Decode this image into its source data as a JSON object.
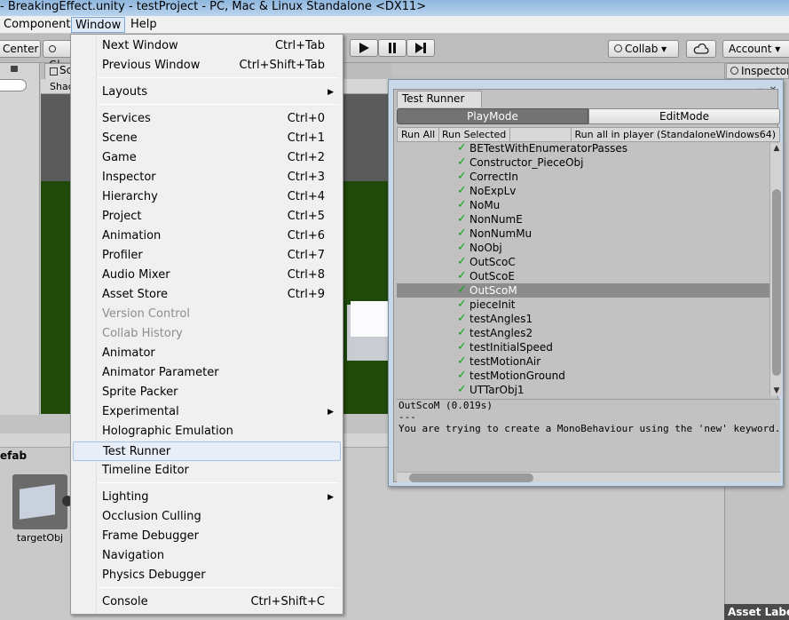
{
  "window_title": "- BreakingEffect.unity - testProject - PC, Mac & Linux Standalone <DX11>",
  "menubar": {
    "items": [
      {
        "label": "Component"
      },
      {
        "label": "Window"
      },
      {
        "label": "Help"
      }
    ]
  },
  "toolbar": {
    "center_label": "Center",
    "global_label": "Gl",
    "collab_label": "Collab ▾",
    "account_label": "Account ▾",
    "play_icon": "play-icon",
    "pause_icon": "pause-icon",
    "step_icon": "step-icon",
    "cloud_icon": "cloud-icon"
  },
  "scene": {
    "tab_label": "Sc",
    "shading_label": "Shad"
  },
  "inspector": {
    "tab_label": "Inspector"
  },
  "project": {
    "title": "efab",
    "asset_name": "targetObj"
  },
  "asset_labels": "Asset Labels",
  "window_menu": {
    "items": [
      {
        "label": "Next Window",
        "shortcut": "Ctrl+Tab"
      },
      {
        "label": "Previous Window",
        "shortcut": "Ctrl+Shift+Tab"
      },
      {
        "label": "Layouts",
        "shortcut": ""
      },
      {
        "label": "Services",
        "shortcut": "Ctrl+0"
      },
      {
        "label": "Scene",
        "shortcut": "Ctrl+1"
      },
      {
        "label": "Game",
        "shortcut": "Ctrl+2"
      },
      {
        "label": "Inspector",
        "shortcut": "Ctrl+3"
      },
      {
        "label": "Hierarchy",
        "shortcut": "Ctrl+4"
      },
      {
        "label": "Project",
        "shortcut": "Ctrl+5"
      },
      {
        "label": "Animation",
        "shortcut": "Ctrl+6"
      },
      {
        "label": "Profiler",
        "shortcut": "Ctrl+7"
      },
      {
        "label": "Audio Mixer",
        "shortcut": "Ctrl+8"
      },
      {
        "label": "Asset Store",
        "shortcut": "Ctrl+9"
      },
      {
        "label": "Version Control",
        "shortcut": ""
      },
      {
        "label": "Collab History",
        "shortcut": ""
      },
      {
        "label": "Animator",
        "shortcut": ""
      },
      {
        "label": "Animator Parameter",
        "shortcut": ""
      },
      {
        "label": "Sprite Packer",
        "shortcut": ""
      },
      {
        "label": "Experimental",
        "shortcut": ""
      },
      {
        "label": "Holographic Emulation",
        "shortcut": ""
      },
      {
        "label": "Test Runner",
        "shortcut": ""
      },
      {
        "label": "Timeline Editor",
        "shortcut": ""
      },
      {
        "label": "Lighting",
        "shortcut": ""
      },
      {
        "label": "Occlusion Culling",
        "shortcut": ""
      },
      {
        "label": "Frame Debugger",
        "shortcut": ""
      },
      {
        "label": "Navigation",
        "shortcut": ""
      },
      {
        "label": "Physics Debugger",
        "shortcut": ""
      },
      {
        "label": "Console",
        "shortcut": "Ctrl+Shift+C"
      }
    ]
  },
  "test_runner": {
    "tab_label": "Test Runner",
    "modes": [
      "PlayMode",
      "EditMode"
    ],
    "active_mode": "PlayMode",
    "run_all": "Run All",
    "run_selected": "Run Selected",
    "run_all_player": "Run all in player (StandaloneWindows64)",
    "tests": [
      "BETestWithEnumeratorPasses",
      "Constructor_PieceObj",
      "CorrectIn",
      "NoExpLv",
      "NoMu",
      "NonNumE",
      "NonNumMu",
      "NoObj",
      "OutScoC",
      "OutScoE",
      "OutScoM",
      "pieceInit",
      "testAngles1",
      "testAngles2",
      "testInitialSpeed",
      "testMotionAir",
      "testMotionGround",
      "UTTarObj1"
    ],
    "selected_test": "OutScoM",
    "detail_lines": [
      "OutScoM (0.019s)",
      "---",
      "You are trying to create a MonoBehaviour using the 'new' keyword.  This is"
    ],
    "status_color": "#15a31d"
  }
}
